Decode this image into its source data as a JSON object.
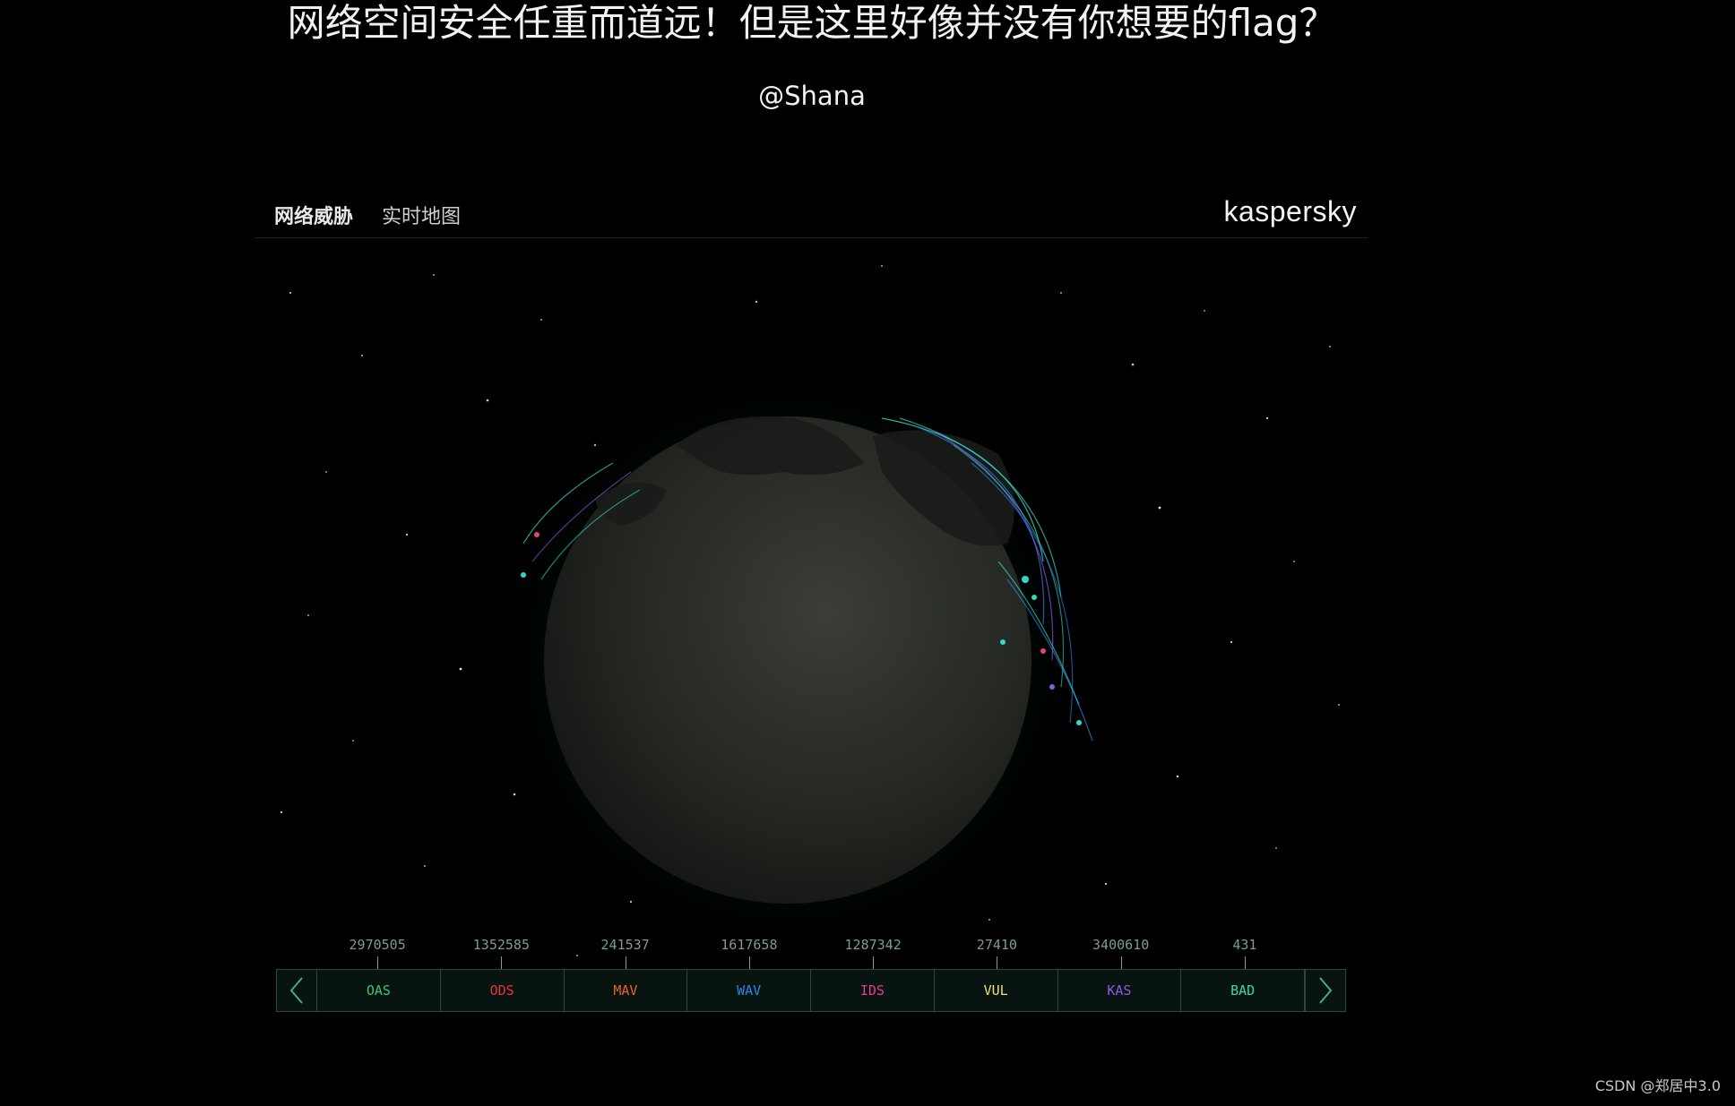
{
  "heading": "网络空间安全任重而道远！但是这里好像并没有你想要的flag？",
  "author": "@Shana",
  "map": {
    "title": "网络威胁",
    "subtitle": "实时地图",
    "brand": "kaspersky"
  },
  "legend": {
    "items": [
      {
        "count": "2970505",
        "label": "OAS",
        "color": "#3cc476"
      },
      {
        "count": "1352585",
        "label": "ODS",
        "color": "#e8343a"
      },
      {
        "count": "241537",
        "label": "MAV",
        "color": "#e8652a"
      },
      {
        "count": "1617658",
        "label": "WAV",
        "color": "#2c86e8"
      },
      {
        "count": "1287342",
        "label": "IDS",
        "color": "#e83c8c"
      },
      {
        "count": "27410",
        "label": "VUL",
        "color": "#f0e070"
      },
      {
        "count": "3400610",
        "label": "KAS",
        "color": "#8c5ae8"
      },
      {
        "count": "431",
        "label": "BAD",
        "color": "#3cd8a8"
      }
    ]
  },
  "watermark": "CSDN @郑居中3.0"
}
